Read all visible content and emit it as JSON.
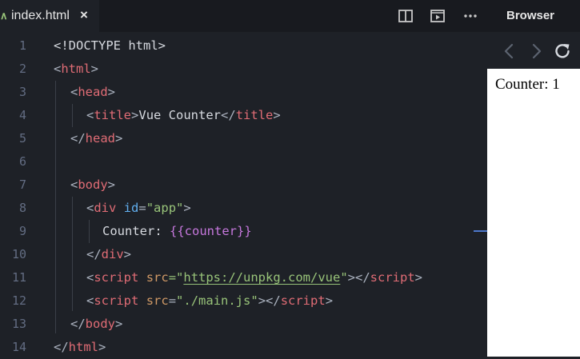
{
  "tab": {
    "label": "index.html",
    "close": "×"
  },
  "toolbar": {
    "icons": [
      "split-editor-icon",
      "preview-icon",
      "more-icon"
    ]
  },
  "browser": {
    "title": "Browser",
    "preview_text": "Counter: 1",
    "nav_icons": [
      "back-icon",
      "forward-icon",
      "reload-icon"
    ]
  },
  "editor": {
    "line_numbers": [
      "1",
      "2",
      "3",
      "4",
      "5",
      "6",
      "7",
      "8",
      "9",
      "10",
      "11",
      "12",
      "13",
      "14"
    ],
    "lines": [
      [
        "<!DOCTYPE html>"
      ],
      [
        "<",
        "html",
        ">"
      ],
      [
        "<",
        "head",
        ">"
      ],
      [
        "<",
        "title",
        ">",
        "Vue Counter",
        "</",
        "title",
        ">"
      ],
      [
        "</",
        "head",
        ">"
      ],
      [],
      [
        "<",
        "body",
        ">"
      ],
      [
        "<",
        "div",
        " ",
        "id",
        "=",
        "\"app\"",
        ">"
      ],
      [
        "Counter: ",
        "{{",
        "counter",
        "}}"
      ],
      [
        "</",
        "div",
        ">"
      ],
      [
        "<",
        "script",
        " ",
        "src",
        "=\"",
        "https://unpkg.com/vue",
        "\"",
        "></",
        "script",
        ">"
      ],
      [
        "<",
        "script",
        " ",
        "src",
        "=",
        "\"./main.js\"",
        "></",
        "script",
        ">"
      ],
      [
        "</",
        "body",
        ">"
      ],
      [
        "</",
        "html",
        ">"
      ]
    ]
  }
}
